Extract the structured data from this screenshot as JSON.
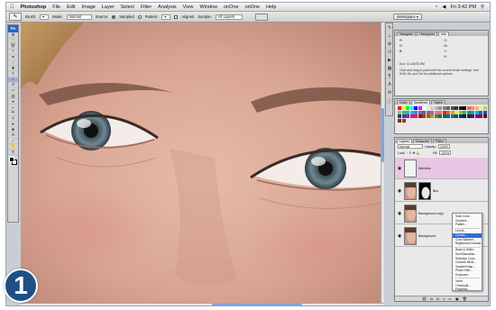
{
  "menubar": {
    "apple": "",
    "app": "Photoshop",
    "items": [
      "File",
      "Edit",
      "Image",
      "Layer",
      "Select",
      "Filter",
      "Analysis",
      "View",
      "Window",
      "onOne",
      "onOne",
      "Help"
    ],
    "clock": "Fri 3:42 PM"
  },
  "options": {
    "tool_icon": "brush-icon",
    "brush_label": "Brush:",
    "mode_label": "Mode:",
    "mode_value": "Normal",
    "source_label": "Source:",
    "sampled_label": "Sampled",
    "pattern_label": "Pattern:",
    "aligned_label": "Aligned",
    "sample_label": "Sample:",
    "sample_value": "All Layers",
    "workspace_label": "Workspace ▾"
  },
  "tools": {
    "ps_label": "Ps",
    "items": [
      "move-icon",
      "marquee-icon",
      "lasso-icon",
      "magic-wand-icon",
      "crop-icon",
      "slice-icon",
      "healing-icon",
      "brush-icon",
      "stamp-icon",
      "history-brush-icon",
      "eraser-icon",
      "gradient-icon",
      "blur-icon",
      "dodge-icon",
      "pen-icon",
      "type-icon",
      "path-select-icon",
      "shape-icon",
      "notes-icon",
      "eyedropper-icon",
      "hand-icon",
      "zoom-icon"
    ]
  },
  "panels": {
    "navigator": {
      "tabs": [
        "Navigator",
        "Histogram",
        "Info"
      ],
      "info_rows": [
        "R:",
        "C:",
        "G:",
        "M:",
        "B:",
        "Y:",
        "",
        "K:"
      ],
      "doc_label": "Doc: 14.1M/33.9M",
      "help_text": "Click and drag to paint with the current brush settings. Use Shift, Alt, and Ctrl for additional options."
    },
    "swatches": {
      "tabs": [
        "Color",
        "Swatches",
        "Styles"
      ]
    },
    "layers": {
      "tabs": [
        "Layers",
        "Channels",
        "Paths"
      ],
      "blend_mode": "Normal",
      "opacity_label": "Opacity:",
      "opacity_value": "100%",
      "lock_label": "Lock:",
      "fill_label": "Fill:",
      "fill_value": "100%",
      "rows": [
        {
          "name": "Wrinkles",
          "selected": true
        },
        {
          "name": "",
          "selected": false,
          "mask_label": "Blur"
        },
        {
          "name": "Background copy",
          "selected": false
        },
        {
          "name": "Background",
          "selected": false
        }
      ]
    },
    "context_menu": {
      "items": [
        "Solid Color...",
        "Gradient...",
        "Pattern...",
        "---",
        "Levels...",
        "Curves...",
        "Color Balance...",
        "Brightness/Contrast...",
        "---",
        "Black & White...",
        "Hue/Saturation...",
        "Selective Color...",
        "Channel Mixer...",
        "Gradient Map...",
        "Photo Filter...",
        "Exposure...",
        "---",
        "Invert",
        "Threshold...",
        "Posterize..."
      ],
      "highlighted_index": 5
    }
  },
  "step_badge": "1",
  "colors": {
    "accent": "#2f6fd8",
    "badge": "#1f4f86",
    "selected_layer": "#e7c7e3"
  }
}
